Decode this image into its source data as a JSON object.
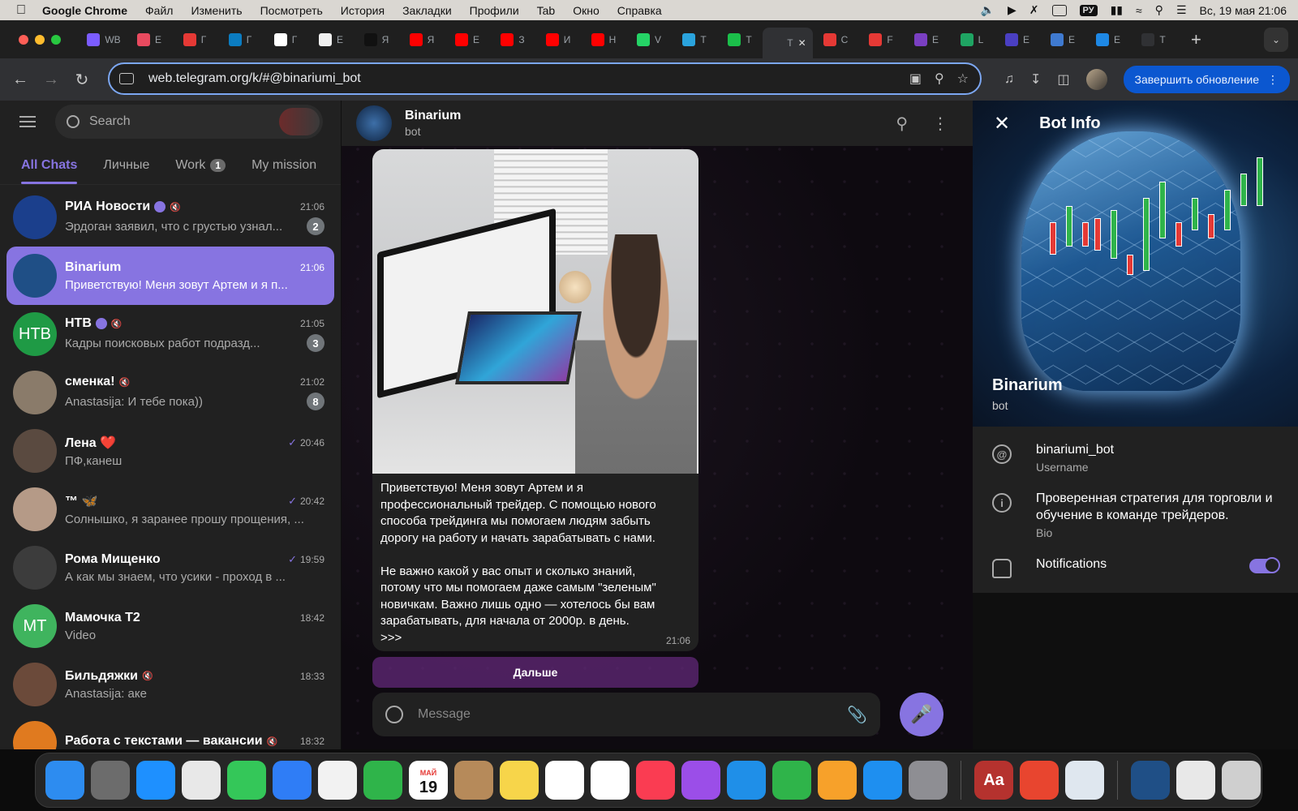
{
  "menubar": {
    "app": "Google Chrome",
    "items": [
      "Файл",
      "Изменить",
      "Посмотреть",
      "История",
      "Закладки",
      "Профили",
      "Tab",
      "Окно",
      "Справка"
    ],
    "keyboard": "РУ",
    "datetime": "Вс, 19 мая  21:06"
  },
  "tabs": [
    {
      "fav": "#7b5cff",
      "label": "WB"
    },
    {
      "fav": "#e84a5f",
      "label": "E"
    },
    {
      "fav": "#e53935",
      "label": "Г"
    },
    {
      "fav": "#0b7cc1",
      "label": "Г"
    },
    {
      "fav": "#ffffff",
      "label": "Г"
    },
    {
      "fav": "#f0f0f0",
      "label": "E"
    },
    {
      "fav": "#111111",
      "label": "Я"
    },
    {
      "fav": "#ff0000",
      "label": "Я"
    },
    {
      "fav": "#ff0000",
      "label": "E"
    },
    {
      "fav": "#ff0000",
      "label": "З"
    },
    {
      "fav": "#ff0000",
      "label": "И"
    },
    {
      "fav": "#ff0000",
      "label": "Н"
    },
    {
      "fav": "#25d366",
      "label": "V"
    },
    {
      "fav": "#2aa3dd",
      "label": "T"
    },
    {
      "fav": "#1bbf4a",
      "label": "T"
    },
    {
      "fav": "#303134",
      "label": "T",
      "active": true
    },
    {
      "fav": "#e53935",
      "label": "C"
    },
    {
      "fav": "#e53935",
      "label": "F"
    },
    {
      "fav": "#7a3fc2",
      "label": "E"
    },
    {
      "fav": "#1fa463",
      "label": "L"
    },
    {
      "fav": "#4a3fc2",
      "label": "E"
    },
    {
      "fav": "#3f7ad0",
      "label": "E"
    },
    {
      "fav": "#1e88e5",
      "label": "E"
    },
    {
      "fav": "#303134",
      "label": "T"
    }
  ],
  "toolbar": {
    "url": "web.telegram.org/k/#@binariumi_bot",
    "update_label": "Завершить обновление"
  },
  "sidebar": {
    "search_placeholder": "Search",
    "folders": [
      {
        "label": "All Chats",
        "active": true
      },
      {
        "label": "Личные"
      },
      {
        "label": "Work",
        "badge": "1"
      },
      {
        "label": "My mission"
      }
    ],
    "chats": [
      {
        "name": "РИА Новости",
        "verified": true,
        "muted": true,
        "time": "21:06",
        "preview": "Эрдоган заявил, что с грустью узнал...",
        "badge": "2",
        "avatar": "#1b3f8c",
        "initials": ""
      },
      {
        "name": "Binarium",
        "time": "21:06",
        "preview": "Приветствую! Меня зовут Артем и я п...",
        "active": true,
        "avatar": "#1f4f86",
        "initials": ""
      },
      {
        "name": "НТВ",
        "verified": true,
        "muted": true,
        "time": "21:05",
        "preview": "Кадры поисковых работ подразд...",
        "badge": "3",
        "avatar": "#1f9a45",
        "initials": "НТВ"
      },
      {
        "name": "сменка!",
        "muted": true,
        "time": "21:02",
        "preview": "Anastasija: И тебе пока))",
        "badge": "8",
        "avatar": "#8a7b6a",
        "initials": ""
      },
      {
        "name": "Лена ❤️",
        "time": "20:46",
        "read": true,
        "preview": "ПФ,канеш",
        "avatar": "#5a4a40",
        "initials": ""
      },
      {
        "name": "™ 🦋",
        "time": "20:42",
        "read": true,
        "preview": "Солнышко, я заранее прошу прощения, ...",
        "avatar": "#b59a87",
        "initials": ""
      },
      {
        "name": "Рома Мищенко",
        "time": "19:59",
        "read": true,
        "preview": "А как мы знаем, что усики - проход в ...",
        "avatar": "#3c3c3c",
        "initials": ""
      },
      {
        "name": "Мамочка Т2",
        "time": "18:42",
        "preview": "Video",
        "avatar": "#3fb45e",
        "initials": "МТ"
      },
      {
        "name": "Бильдяжки",
        "muted": true,
        "time": "18:33",
        "preview": "Anastasija: аке",
        "avatar": "#6b4a3a",
        "initials": ""
      },
      {
        "name": "Работа с текстами — вакансии",
        "muted": true,
        "time": "18:32",
        "preview": "",
        "avatar": "#e07a1f",
        "initials": ""
      }
    ]
  },
  "chat": {
    "title": "Binarium",
    "subtitle": "bot",
    "message_text": "Приветствую! Меня зовут Артем и я\nпрофессиональный трейдер. С помощью нового\nспособа трейдинга мы помогаем людям забыть\nдорогу на работу и начать зарабатывать с нами.\n\nНе важно какой у вас опыт и сколько знаний,\nпотому что мы помогаем даже самым \"зеленым\"\nновичкам. Важно лишь одно — хотелось бы вам\nзарабатывать, для начала от 2000р. в день.\n>>>",
    "message_time": "21:06",
    "keyboard_button": "Дальше",
    "composer_placeholder": "Message"
  },
  "botinfo": {
    "title": "Bot Info",
    "name": "Binarium",
    "subtitle": "bot",
    "username": "binariumi_bot",
    "username_label": "Username",
    "bio": "Проверенная стратегия для торговли и обучение в команде трейдеров.",
    "bio_label": "Bio",
    "notifications_label": "Notifications",
    "notifications_on": true
  },
  "dock": {
    "calendar_month": "МАЙ",
    "calendar_day": "19",
    "dictionary_label": "Aa",
    "apps": [
      {
        "name": "finder",
        "color": "#2d8cf0"
      },
      {
        "name": "launchpad",
        "color": "#6c6c6c"
      },
      {
        "name": "safari",
        "color": "#1e90ff"
      },
      {
        "name": "chrome",
        "color": "#e8e8e8"
      },
      {
        "name": "messages",
        "color": "#34c759"
      },
      {
        "name": "mail",
        "color": "#2f7df6"
      },
      {
        "name": "photos",
        "color": "#f2f2f2"
      },
      {
        "name": "facetime",
        "color": "#2fb44a"
      },
      {
        "name": "calendar",
        "color": "#ffffff"
      },
      {
        "name": "contacts",
        "color": "#b68a5a"
      },
      {
        "name": "notes",
        "color": "#f7d54a"
      },
      {
        "name": "freeform",
        "color": "#ffffff"
      },
      {
        "name": "reminders",
        "color": "#ffffff"
      },
      {
        "name": "music",
        "color": "#fa3c52"
      },
      {
        "name": "podcasts",
        "color": "#9b4ee8"
      },
      {
        "name": "keynote",
        "color": "#1f8fe8"
      },
      {
        "name": "numbers",
        "color": "#2fb44a"
      },
      {
        "name": "pages",
        "color": "#f7a12a"
      },
      {
        "name": "appstore",
        "color": "#1e8ff0"
      },
      {
        "name": "settings",
        "color": "#8e8e93"
      }
    ],
    "apps2": [
      {
        "name": "dictionary",
        "color": "#b5322e"
      },
      {
        "name": "anydesk",
        "color": "#e8452f"
      },
      {
        "name": "preview",
        "color": "#dfe7ef"
      }
    ],
    "apps3": [
      {
        "name": "window-binarium",
        "color": "#1f4f86"
      },
      {
        "name": "window-doc",
        "color": "#e8e8e8"
      },
      {
        "name": "trash",
        "color": "#cfcfcf"
      }
    ]
  },
  "colors": {
    "accent": "#8774e1",
    "panel": "#212121",
    "link_blue": "#0b57d0"
  }
}
